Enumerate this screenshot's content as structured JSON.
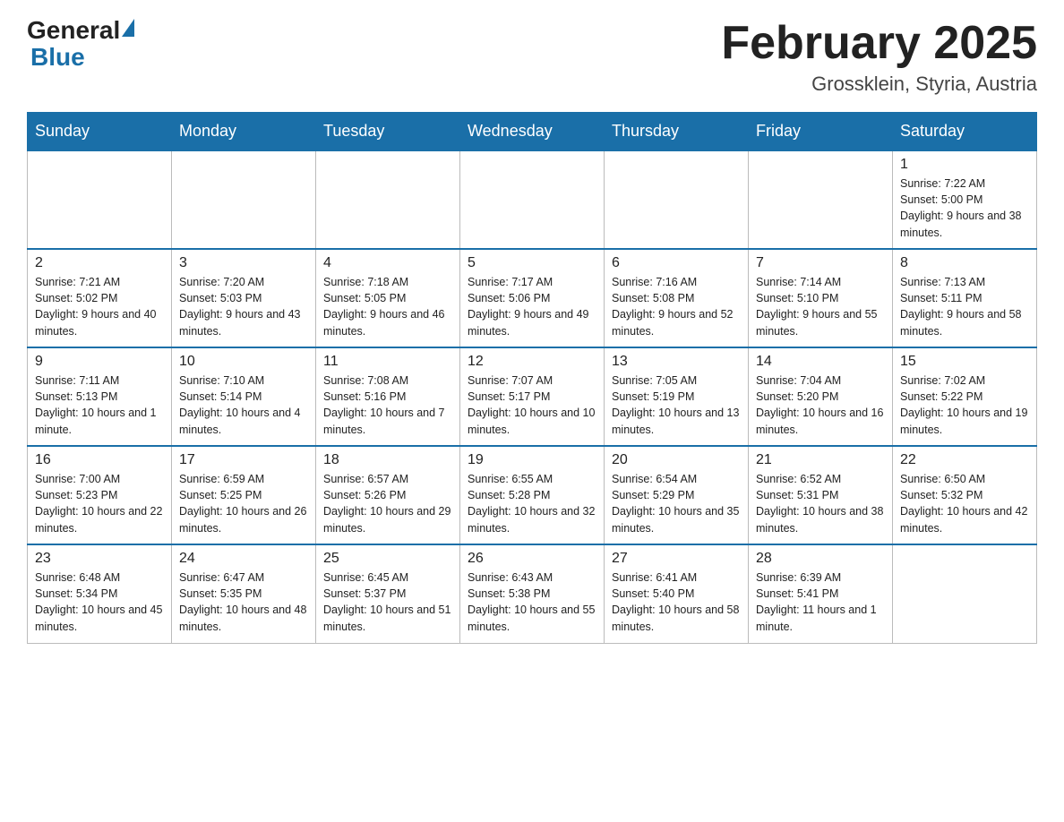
{
  "logo": {
    "general": "General",
    "blue": "Blue"
  },
  "title": {
    "month_year": "February 2025",
    "location": "Grossklein, Styria, Austria"
  },
  "weekdays": [
    "Sunday",
    "Monday",
    "Tuesday",
    "Wednesday",
    "Thursday",
    "Friday",
    "Saturday"
  ],
  "weeks": [
    [
      {
        "day": "",
        "info": ""
      },
      {
        "day": "",
        "info": ""
      },
      {
        "day": "",
        "info": ""
      },
      {
        "day": "",
        "info": ""
      },
      {
        "day": "",
        "info": ""
      },
      {
        "day": "",
        "info": ""
      },
      {
        "day": "1",
        "info": "Sunrise: 7:22 AM\nSunset: 5:00 PM\nDaylight: 9 hours and 38 minutes."
      }
    ],
    [
      {
        "day": "2",
        "info": "Sunrise: 7:21 AM\nSunset: 5:02 PM\nDaylight: 9 hours and 40 minutes."
      },
      {
        "day": "3",
        "info": "Sunrise: 7:20 AM\nSunset: 5:03 PM\nDaylight: 9 hours and 43 minutes."
      },
      {
        "day": "4",
        "info": "Sunrise: 7:18 AM\nSunset: 5:05 PM\nDaylight: 9 hours and 46 minutes."
      },
      {
        "day": "5",
        "info": "Sunrise: 7:17 AM\nSunset: 5:06 PM\nDaylight: 9 hours and 49 minutes."
      },
      {
        "day": "6",
        "info": "Sunrise: 7:16 AM\nSunset: 5:08 PM\nDaylight: 9 hours and 52 minutes."
      },
      {
        "day": "7",
        "info": "Sunrise: 7:14 AM\nSunset: 5:10 PM\nDaylight: 9 hours and 55 minutes."
      },
      {
        "day": "8",
        "info": "Sunrise: 7:13 AM\nSunset: 5:11 PM\nDaylight: 9 hours and 58 minutes."
      }
    ],
    [
      {
        "day": "9",
        "info": "Sunrise: 7:11 AM\nSunset: 5:13 PM\nDaylight: 10 hours and 1 minute."
      },
      {
        "day": "10",
        "info": "Sunrise: 7:10 AM\nSunset: 5:14 PM\nDaylight: 10 hours and 4 minutes."
      },
      {
        "day": "11",
        "info": "Sunrise: 7:08 AM\nSunset: 5:16 PM\nDaylight: 10 hours and 7 minutes."
      },
      {
        "day": "12",
        "info": "Sunrise: 7:07 AM\nSunset: 5:17 PM\nDaylight: 10 hours and 10 minutes."
      },
      {
        "day": "13",
        "info": "Sunrise: 7:05 AM\nSunset: 5:19 PM\nDaylight: 10 hours and 13 minutes."
      },
      {
        "day": "14",
        "info": "Sunrise: 7:04 AM\nSunset: 5:20 PM\nDaylight: 10 hours and 16 minutes."
      },
      {
        "day": "15",
        "info": "Sunrise: 7:02 AM\nSunset: 5:22 PM\nDaylight: 10 hours and 19 minutes."
      }
    ],
    [
      {
        "day": "16",
        "info": "Sunrise: 7:00 AM\nSunset: 5:23 PM\nDaylight: 10 hours and 22 minutes."
      },
      {
        "day": "17",
        "info": "Sunrise: 6:59 AM\nSunset: 5:25 PM\nDaylight: 10 hours and 26 minutes."
      },
      {
        "day": "18",
        "info": "Sunrise: 6:57 AM\nSunset: 5:26 PM\nDaylight: 10 hours and 29 minutes."
      },
      {
        "day": "19",
        "info": "Sunrise: 6:55 AM\nSunset: 5:28 PM\nDaylight: 10 hours and 32 minutes."
      },
      {
        "day": "20",
        "info": "Sunrise: 6:54 AM\nSunset: 5:29 PM\nDaylight: 10 hours and 35 minutes."
      },
      {
        "day": "21",
        "info": "Sunrise: 6:52 AM\nSunset: 5:31 PM\nDaylight: 10 hours and 38 minutes."
      },
      {
        "day": "22",
        "info": "Sunrise: 6:50 AM\nSunset: 5:32 PM\nDaylight: 10 hours and 42 minutes."
      }
    ],
    [
      {
        "day": "23",
        "info": "Sunrise: 6:48 AM\nSunset: 5:34 PM\nDaylight: 10 hours and 45 minutes."
      },
      {
        "day": "24",
        "info": "Sunrise: 6:47 AM\nSunset: 5:35 PM\nDaylight: 10 hours and 48 minutes."
      },
      {
        "day": "25",
        "info": "Sunrise: 6:45 AM\nSunset: 5:37 PM\nDaylight: 10 hours and 51 minutes."
      },
      {
        "day": "26",
        "info": "Sunrise: 6:43 AM\nSunset: 5:38 PM\nDaylight: 10 hours and 55 minutes."
      },
      {
        "day": "27",
        "info": "Sunrise: 6:41 AM\nSunset: 5:40 PM\nDaylight: 10 hours and 58 minutes."
      },
      {
        "day": "28",
        "info": "Sunrise: 6:39 AM\nSunset: 5:41 PM\nDaylight: 11 hours and 1 minute."
      },
      {
        "day": "",
        "info": ""
      }
    ]
  ]
}
